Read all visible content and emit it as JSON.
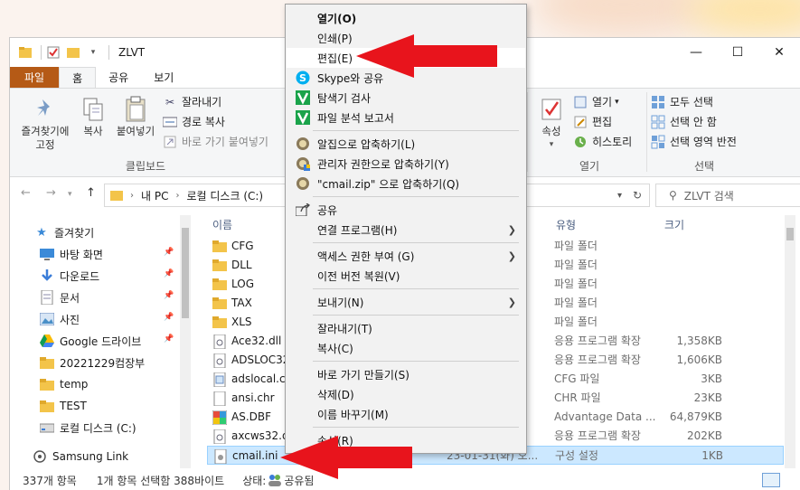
{
  "window": {
    "title": "ZLVT",
    "controls": {
      "minimize": "—",
      "maximize": "☐",
      "close": "✕"
    }
  },
  "tabs": [
    "파일",
    "홈",
    "공유",
    "보기"
  ],
  "ribbon": {
    "clipboard": {
      "group_label": "클립보드",
      "pin_label": "즐겨찾기에\n고정",
      "copy_label": "복사",
      "paste_label": "붙여넣기",
      "cut_label": "잘라내기",
      "copy_path_label": "경로 복사",
      "paste_shortcut_label": "바로 가기 붙여넣기"
    },
    "open": {
      "group_label": "열기",
      "properties_label": "속성",
      "open_label": "열기",
      "edit_label": "편집",
      "history_label": "히스토리"
    },
    "select": {
      "group_label": "선택",
      "select_all_label": "모두 선택",
      "select_none_label": "선택 안 함",
      "invert_label": "선택 영역 반전"
    }
  },
  "address": {
    "segments": [
      "내 PC",
      "로컬 디스크 (C:)"
    ],
    "search_placeholder": "ZLVT 검색"
  },
  "navpane": {
    "items": [
      {
        "label": "즐겨찾기",
        "icon": "star-icon"
      },
      {
        "label": "바탕 화면",
        "icon": "desktop-icon",
        "pinned": true
      },
      {
        "label": "다운로드",
        "icon": "download-icon",
        "pinned": true
      },
      {
        "label": "문서",
        "icon": "document-icon",
        "pinned": true
      },
      {
        "label": "사진",
        "icon": "pictures-icon",
        "pinned": true
      },
      {
        "label": "Google 드라이브",
        "icon": "google-drive-icon",
        "pinned": true
      },
      {
        "label": "20221229컴장부",
        "icon": "folder-icon"
      },
      {
        "label": "temp",
        "icon": "folder-icon"
      },
      {
        "label": "TEST",
        "icon": "folder-icon"
      },
      {
        "label": "로컬 디스크 (C:)",
        "icon": "drive-icon"
      },
      {
        "label": "Samsung Link",
        "icon": "samsung-link-icon"
      }
    ]
  },
  "filelist": {
    "headers": {
      "name": "이름",
      "type": "유형",
      "size": "크기"
    },
    "rows": [
      {
        "name": "CFG",
        "type": "파일 폴더",
        "size": "",
        "icon": "folder-icon"
      },
      {
        "name": "DLL",
        "type": "파일 폴더",
        "size": "",
        "icon": "folder-icon"
      },
      {
        "name": "LOG",
        "type": "파일 폴더",
        "size": "",
        "icon": "folder-icon"
      },
      {
        "name": "TAX",
        "type": "파일 폴더",
        "size": "",
        "icon": "folder-icon"
      },
      {
        "name": "XLS",
        "type": "파일 폴더",
        "size": "",
        "icon": "folder-icon"
      },
      {
        "name": "Ace32.dll",
        "type": "응용 프로그램 확장",
        "size": "1,358KB",
        "icon": "dll-icon"
      },
      {
        "name": "ADSLOC32",
        "type": "응용 프로그램 확장",
        "size": "1,606KB",
        "icon": "dll-icon"
      },
      {
        "name": "adslocal.cfg",
        "type": "CFG 파일",
        "size": "3KB",
        "icon": "cfg-icon"
      },
      {
        "name": "ansi.chr",
        "type": "CHR 파일",
        "size": "23KB",
        "icon": "file-icon"
      },
      {
        "name": "AS.DBF",
        "type": "Advantage Data ...",
        "size": "64,879KB",
        "icon": "dbf-icon"
      },
      {
        "name": "axcws32.dll",
        "type": "응용 프로그램 확장",
        "size": "202KB",
        "icon": "dll-icon"
      },
      {
        "name": "cmail.ini",
        "type": "구성 설정",
        "size": "1KB",
        "icon": "ini-icon",
        "date": "23-01-31(화) 오...",
        "selected": true
      }
    ]
  },
  "statusbar": {
    "count": "337개 항목",
    "selection": "1개 항목 선택함 388바이트",
    "state": "상태:",
    "shared": "공유됨"
  },
  "context_menu": {
    "items": [
      {
        "label": "열기(O)",
        "bold": true
      },
      {
        "label": "인쇄(P)"
      },
      {
        "label": "편집(E)",
        "highlight": true
      },
      {
        "label": "Skype와 공유",
        "icon": "skype-icon"
      },
      {
        "label": "탐색기 검사",
        "icon": "v3-icon"
      },
      {
        "label": "파일 분석 보고서",
        "icon": "v3-icon"
      },
      {
        "sep": true
      },
      {
        "label": "알집으로 압축하기(L)",
        "icon": "alzip-icon"
      },
      {
        "label": "관리자 권한으로 압축하기(Y)",
        "icon": "alzip-admin-icon"
      },
      {
        "label": "\"cmail.zip\" 으로 압축하기(Q)",
        "icon": "alzip-icon"
      },
      {
        "sep": true
      },
      {
        "label": "공유",
        "icon": "share-icon"
      },
      {
        "label": "연결 프로그램(H)",
        "submenu": true
      },
      {
        "sep": true
      },
      {
        "label": "액세스 권한 부여 (G)",
        "submenu": true
      },
      {
        "label": "이전 버전 복원(V)"
      },
      {
        "sep": true
      },
      {
        "label": "보내기(N)",
        "submenu": true
      },
      {
        "sep": true
      },
      {
        "label": "잘라내기(T)"
      },
      {
        "label": "복사(C)"
      },
      {
        "sep": true
      },
      {
        "label": "바로 가기 만들기(S)"
      },
      {
        "label": "삭제(D)"
      },
      {
        "label": "이름 바꾸기(M)"
      },
      {
        "sep": true
      },
      {
        "label": "속성(R)"
      }
    ]
  },
  "colors": {
    "file_tab": "#b55a16",
    "selection": "#cce8ff",
    "arrow": "#e8141c",
    "folder": "#f3c44a"
  }
}
